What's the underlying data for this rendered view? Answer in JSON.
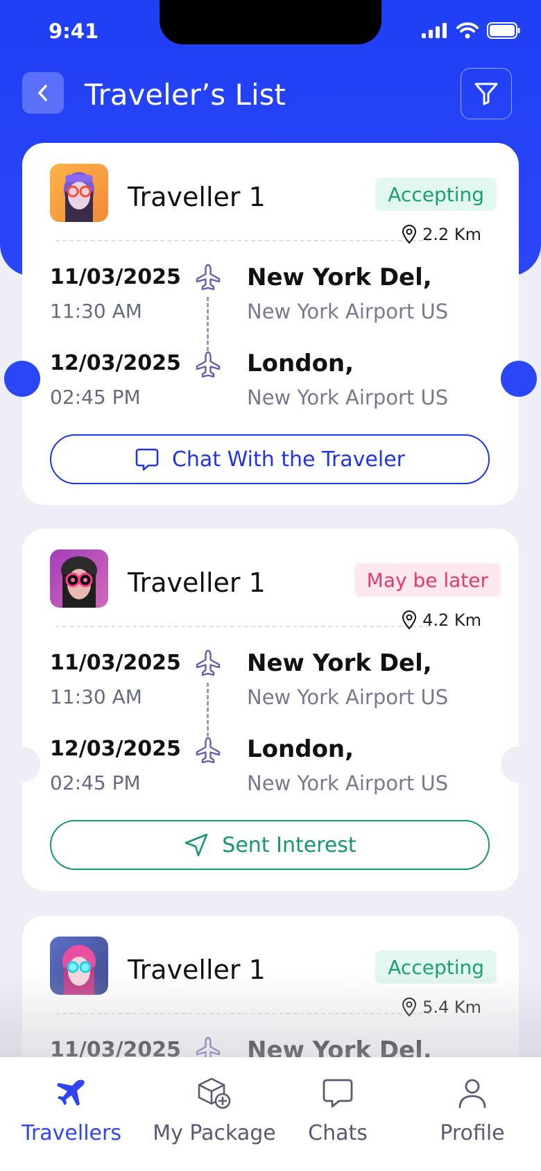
{
  "status_bar": {
    "time": "9:41"
  },
  "header": {
    "title": "Traveler’s List"
  },
  "travellers": [
    {
      "name": "Traveller 1",
      "status": "Accepting",
      "distance": "2.2 Km",
      "depart_date": "11/03/2025",
      "depart_time": "11:30 AM",
      "depart_city": "New York Del,",
      "depart_airport": "New York Airport US",
      "arrive_date": "12/03/2025",
      "arrive_time": "02:45 PM",
      "arrive_city": "London,",
      "arrive_airport": "New York Airport US",
      "action": "Chat With the Traveler"
    },
    {
      "name": "Traveller 1",
      "status": "May be later",
      "distance": "4.2 Km",
      "depart_date": "11/03/2025",
      "depart_time": "11:30 AM",
      "depart_city": "New York Del,",
      "depart_airport": "New York Airport US",
      "arrive_date": "12/03/2025",
      "arrive_time": "02:45 PM",
      "arrive_city": "London,",
      "arrive_airport": "New York Airport US",
      "action": "Sent Interest"
    },
    {
      "name": "Traveller 1",
      "status": "Accepting",
      "distance": "5.4 Km",
      "depart_date": "11/03/2025",
      "depart_city": "New York Del,"
    }
  ],
  "tabs": [
    {
      "label": "Travellers",
      "icon": "plane-icon",
      "active": true
    },
    {
      "label": "My Package",
      "icon": "package-icon",
      "active": false
    },
    {
      "label": "Chats",
      "icon": "chat-icon",
      "active": false
    },
    {
      "label": "Profile",
      "icon": "profile-icon",
      "active": false
    }
  ],
  "colors": {
    "primary": "#2033E6",
    "accepting": "#1AA06E",
    "later": "#E8386A",
    "sent": "#16986A"
  }
}
